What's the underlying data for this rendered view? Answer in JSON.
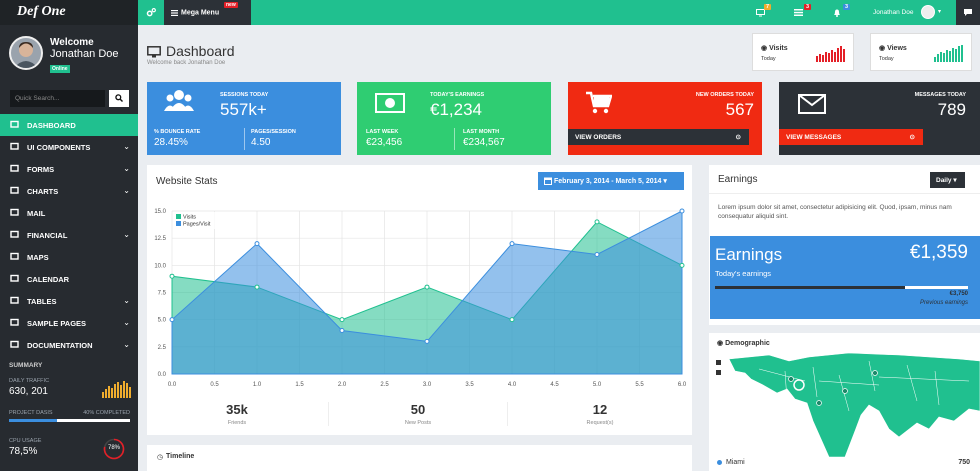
{
  "brand": "Def One",
  "topbar": {
    "mega_menu": "Mega Menu",
    "mega_badge": "new",
    "notif_counts": [
      "7",
      "3",
      "3"
    ],
    "user": "Jonathan Doe"
  },
  "sidebar": {
    "welcome": "Welcome",
    "user": "Jonathan Doe",
    "status": "Online",
    "search_placeholder": "Quick Search...",
    "items": [
      {
        "label": "DASHBOARD",
        "icon": "monitor-icon",
        "active": true,
        "chevron": false
      },
      {
        "label": "UI COMPONENTS",
        "icon": "wrench-icon",
        "chevron": true
      },
      {
        "label": "FORMS",
        "icon": "edit-icon",
        "chevron": true
      },
      {
        "label": "CHARTS",
        "icon": "bar-chart-icon",
        "chevron": true
      },
      {
        "label": "MAIL",
        "icon": "envelope-icon",
        "chevron": false
      },
      {
        "label": "FINANCIAL",
        "icon": "credit-card-icon",
        "chevron": true
      },
      {
        "label": "MAPS",
        "icon": "map-marker-icon",
        "chevron": false
      },
      {
        "label": "CALENDAR",
        "icon": "calendar-icon",
        "chevron": false
      },
      {
        "label": "TABLES",
        "icon": "table-icon",
        "chevron": true
      },
      {
        "label": "SAMPLE PAGES",
        "icon": "file-icon",
        "chevron": true
      },
      {
        "label": "DOCUMENTATION",
        "icon": "book-icon",
        "chevron": true
      }
    ],
    "summary": {
      "title": "SUMMARY",
      "daily_traffic_label": "DAILY TRAFFIC",
      "daily_traffic": "630, 201",
      "project_label": "PROJECT DASIS",
      "project_pct_label": "40% COMPLETED",
      "project_progress": 0.4,
      "cpu_label": "CPU USAGE",
      "cpu": "78,5%",
      "cpu_gauge": "78%"
    }
  },
  "header": {
    "title": "Dashboard",
    "subtitle": "Welcome back Jonathan Doe",
    "visits_label": "Visits",
    "visits_sub": "Today",
    "views_label": "Views",
    "views_sub": "Today"
  },
  "tiles": {
    "sessions": {
      "label": "SESSIONS TODAY",
      "value": "557k+",
      "bounce_label": "% BOUNCE RATE",
      "bounce": "28.45%",
      "pps_label": "PAGES/SESSION",
      "pps": "4.50"
    },
    "earnings": {
      "label": "TODAY'S EARNINGS",
      "value": "€1,234",
      "lw_label": "LAST WEEK",
      "lw": "€23,456",
      "lm_label": "LAST MONTH",
      "lm": "€234,567"
    },
    "orders": {
      "label": "NEW ORDERS TODAY",
      "value": "567",
      "action": "VIEW ORDERS"
    },
    "messages": {
      "label": "MESSAGES TODAY",
      "value": "789",
      "action": "VIEW MESSAGES"
    }
  },
  "website_stats": {
    "title": "Website Stats",
    "date_range": "February 3, 2014 - March 5, 2014",
    "stats": [
      {
        "value": "35k",
        "label": "Friends"
      },
      {
        "value": "50",
        "label": "New Posts"
      },
      {
        "value": "12",
        "label": "Request(s)"
      }
    ]
  },
  "chart_data": {
    "type": "area",
    "x": [
      0,
      1,
      2,
      3,
      4,
      5,
      6
    ],
    "x_ticks": [
      "0.0",
      "0.5",
      "1.0",
      "1.5",
      "2.0",
      "2.5",
      "3.0",
      "3.5",
      "4.0",
      "4.5",
      "5.0",
      "5.5",
      "6.0"
    ],
    "y_ticks": [
      "0.0",
      "2.5",
      "5.0",
      "7.5",
      "10.0",
      "12.5",
      "15.0"
    ],
    "xlim": [
      0,
      6
    ],
    "ylim": [
      0,
      15
    ],
    "grid": true,
    "legend_position": "top-left",
    "series": [
      {
        "name": "Visits",
        "values": [
          9,
          8,
          5,
          8,
          5,
          14,
          10
        ],
        "color": "#20c08f"
      },
      {
        "name": "Pages/Visit",
        "values": [
          5,
          12,
          4,
          3,
          12,
          11,
          15
        ],
        "color": "#3b8ede"
      }
    ]
  },
  "timeline": {
    "title": "Timeline"
  },
  "earnings_panel": {
    "title": "Earnings",
    "period": "Daily",
    "text": "Lorem ipsum dolor sit amet, consectetur adipisicing elit. Quod, ipsam, minus nam consequatur aliquid sint.",
    "big_label": "Earnings",
    "big_value": "€1,359",
    "sub_label": "Today's earnings",
    "progress": 0.75,
    "prev_value": "€3,750",
    "prev_label": "Previous earnings"
  },
  "demographic": {
    "title": "Demographic",
    "legend_label": "Miami",
    "legend_value": "750"
  },
  "colors": {
    "accent": "#20c08f",
    "blue": "#3b8ede",
    "red": "#e41f27",
    "dark": "#272b30",
    "slate": "#2c3137"
  }
}
